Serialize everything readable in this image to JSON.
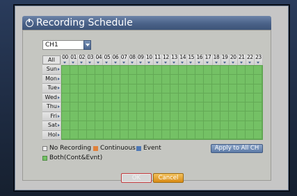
{
  "dialog": {
    "title": "Recording Schedule"
  },
  "channel": {
    "selected": "CH1"
  },
  "schedule": {
    "all_label": "All",
    "hours": [
      "00",
      "01",
      "02",
      "03",
      "04",
      "05",
      "06",
      "07",
      "08",
      "09",
      "10",
      "11",
      "12",
      "13",
      "14",
      "15",
      "16",
      "17",
      "18",
      "19",
      "20",
      "21",
      "22",
      "23"
    ],
    "days": [
      "Sun",
      "Mon",
      "Tue",
      "Wed",
      "Thu",
      "Fri",
      "Sat",
      "Hol"
    ],
    "fill_mode": "Both(Cont&Evnt)"
  },
  "legend": {
    "items": [
      {
        "label": "No Recording",
        "color": "#e8e8e8"
      },
      {
        "label": "Continuous",
        "color": "#e0803a"
      },
      {
        "label": "Event",
        "color": "#4f78b5"
      },
      {
        "label": "Both(Cont&Evnt)",
        "color": "#74c165"
      }
    ]
  },
  "buttons": {
    "apply_all": "Apply to All CH",
    "ok": "OK",
    "cancel": "Cancel"
  },
  "colors": {
    "grid_fill": "#74c165",
    "title_bar": "#4a6289",
    "cancel": "#e09a22"
  }
}
